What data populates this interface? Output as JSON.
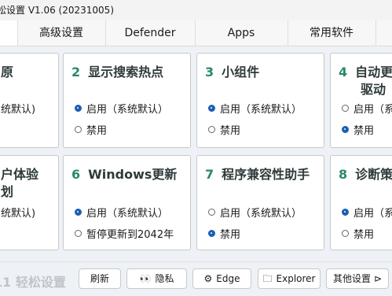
{
  "window": {
    "title": "松设置 V1.06 (20231005)"
  },
  "tabs": [
    "",
    "高级设置",
    "Defender",
    "Apps",
    "常用软件",
    ""
  ],
  "cards": [
    {
      "num": "",
      "title": "原",
      "options": [
        {
          "label": "统默认)",
          "selected": false
        }
      ]
    },
    {
      "num": "2",
      "title": "显示搜索热点",
      "options": [
        {
          "label": "启用（系统默认）",
          "selected": true
        },
        {
          "label": "禁用",
          "selected": false
        }
      ]
    },
    {
      "num": "3",
      "title": "小组件",
      "options": [
        {
          "label": "启用（系统默认）",
          "selected": true
        },
        {
          "label": "禁用",
          "selected": false
        }
      ]
    },
    {
      "num": "4",
      "title": "自动更",
      "title2": "驱动",
      "options": [
        {
          "label": "启用（系",
          "selected": false
        },
        {
          "label": "禁用",
          "selected": true
        }
      ]
    },
    {
      "num": "",
      "title": "户体验",
      "title2": "划",
      "options": [
        {
          "label": "统默认)",
          "selected": false
        }
      ]
    },
    {
      "num": "6",
      "title": "Windows更新",
      "options": [
        {
          "label": "启用（系统默认）",
          "selected": true
        },
        {
          "label": "暂停更新到2042年",
          "selected": false
        }
      ]
    },
    {
      "num": "7",
      "title": "程序兼容性助手",
      "options": [
        {
          "label": "启用（系统默认）",
          "selected": false
        },
        {
          "label": "禁用",
          "selected": true
        }
      ]
    },
    {
      "num": "8",
      "title": "诊断策",
      "options": [
        {
          "label": "启用（系",
          "selected": true
        },
        {
          "label": "禁用",
          "selected": false
        }
      ]
    }
  ],
  "footer": {
    "brand": "11 轻松设置",
    "buttons": [
      {
        "label": "刷新",
        "icon": ""
      },
      {
        "label": "隐私",
        "icon": "eye-icon"
      },
      {
        "label": "Edge",
        "icon": "gear-icon"
      },
      {
        "label": "Explorer",
        "icon": "folder-icon"
      },
      {
        "label": "其他设置",
        "icon": "play-icon"
      }
    ]
  },
  "colors": {
    "accent": "#1a5fb4",
    "number": "#2a8a63"
  }
}
